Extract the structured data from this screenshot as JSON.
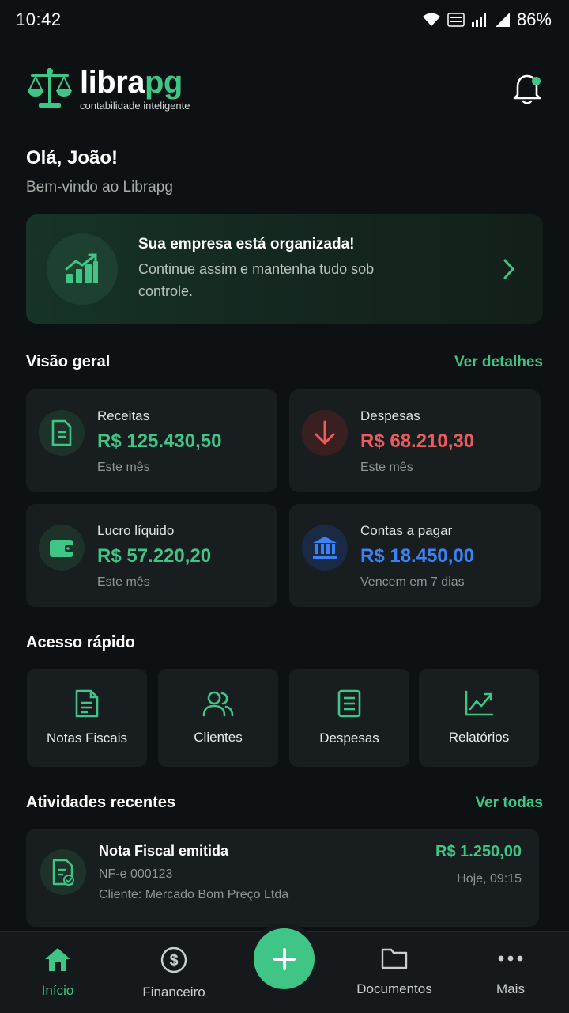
{
  "status_bar": {
    "time": "10:42",
    "battery": "86%"
  },
  "header": {
    "logo_main": "libra",
    "logo_accent": "pg",
    "logo_subtitle": "contabilidade inteligente"
  },
  "greeting": {
    "title": "Olá, João!",
    "subtitle": "Bem-vindo ao Librapg"
  },
  "banner": {
    "title": "Sua empresa está organizada!",
    "text": "Continue assim e mantenha tudo sob controle."
  },
  "overview": {
    "title": "Visão geral",
    "link": "Ver detalhes",
    "cards": [
      {
        "label": "Receitas",
        "value": "R$ 125.430,50",
        "sub": "Este mês",
        "icon": "document-icon",
        "color": "#3fc586"
      },
      {
        "label": "Despesas",
        "value": "R$ 68.210,30",
        "sub": "Este mês",
        "icon": "arrow-down-icon",
        "color": "#ef5a5a"
      },
      {
        "label": "Lucro líquido",
        "value": "R$ 57.220,20",
        "sub": "Este mês",
        "icon": "wallet-icon",
        "color": "#3fc586"
      },
      {
        "label": "Contas a pagar",
        "value": "R$ 18.450,00",
        "sub": "Vencem em 7 dias",
        "icon": "bank-icon",
        "color": "#3b82f6"
      }
    ]
  },
  "quick_access": {
    "title": "Acesso rápido",
    "items": [
      {
        "label": "Notas Fiscais",
        "icon": "invoice-icon"
      },
      {
        "label": "Clientes",
        "icon": "users-icon"
      },
      {
        "label": "Despesas",
        "icon": "list-document-icon"
      },
      {
        "label": "Relatórios",
        "icon": "chart-line-icon"
      }
    ]
  },
  "recent": {
    "title": "Atividades recentes",
    "link": "Ver todas",
    "items": [
      {
        "title": "Nota Fiscal emitida",
        "line1": "NF-e 000123",
        "line2": "Cliente: Mercado Bom Preço Ltda",
        "amount": "R$ 1.250,00",
        "time": "Hoje, 09:15"
      }
    ]
  },
  "tabs": [
    {
      "label": "Início",
      "icon": "home-icon",
      "active": true
    },
    {
      "label": "Financeiro",
      "icon": "dollar-circle-icon",
      "active": false
    },
    {
      "label": "Documentos",
      "icon": "folder-icon",
      "active": false
    },
    {
      "label": "Mais",
      "icon": "more-dots-icon",
      "active": false
    }
  ],
  "colors": {
    "accent": "#3fc586",
    "danger": "#ef5a5a",
    "info": "#3b82f6",
    "background": "#0e1113",
    "card": "#181d20"
  }
}
